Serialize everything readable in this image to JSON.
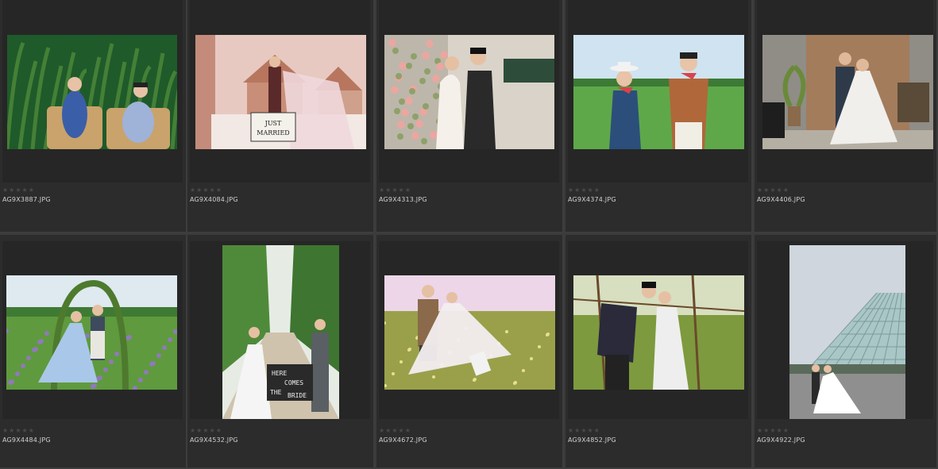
{
  "gallery": {
    "items": [
      {
        "filename": "AG9X3887.JPG",
        "rating": "★★★★★",
        "scene": "garden-rattan-chairs",
        "colors": [
          "#1f5a2a",
          "#4e8a3a",
          "#c9a36b",
          "#3b5ea8"
        ]
      },
      {
        "filename": "AG9X4084.JPG",
        "rating": "★★★★★",
        "scene": "thai-temple-just-married",
        "colors": [
          "#e7c9c1",
          "#c48b7a",
          "#f2e8e4",
          "#5a2a2a"
        ]
      },
      {
        "filename": "AG9X4313.JPG",
        "rating": "★★★★★",
        "scene": "flower-wall-couple",
        "colors": [
          "#d9d3c9",
          "#8fa16a",
          "#2a2a2a",
          "#f5f0ea"
        ]
      },
      {
        "filename": "AG9X4374.JPG",
        "rating": "★★★★★",
        "scene": "watermelon-field",
        "colors": [
          "#cfe3f1",
          "#5fa84a",
          "#2b4f7a",
          "#b0673a"
        ]
      },
      {
        "filename": "AG9X4406.JPG",
        "rating": "★★★★★",
        "scene": "studio-curtain",
        "colors": [
          "#a37c5c",
          "#5a4a3a",
          "#2e3a4a",
          "#f0efec"
        ]
      },
      {
        "filename": "AG9X4484.JPG",
        "rating": "★★★★★",
        "scene": "flower-arch-field",
        "colors": [
          "#dfe9f0",
          "#5f9a3e",
          "#8f7ab8",
          "#a9c7e8"
        ]
      },
      {
        "filename": "AG9X4532.JPG",
        "rating": "★★★★★",
        "scene": "path-here-comes-the-bride",
        "colors": [
          "#e6ece4",
          "#4f8a3a",
          "#cfc3ad",
          "#2a2a2a"
        ]
      },
      {
        "filename": "AG9X4672.JPG",
        "rating": "★★★★★",
        "scene": "meadow-couple",
        "colors": [
          "#ecd6e8",
          "#9aa04a",
          "#8a6a4a",
          "#f3eef0"
        ]
      },
      {
        "filename": "AG9X4852.JPG",
        "rating": "★★★★★",
        "scene": "fence-kiss",
        "colors": [
          "#d7dfc0",
          "#7d9a3e",
          "#2a2a3a",
          "#eeeeee"
        ]
      },
      {
        "filename": "AG9X4922.JPG",
        "rating": "★★★★★",
        "scene": "glass-pyramid",
        "colors": [
          "#cfd6dd",
          "#a9c7c7",
          "#8f8f8f",
          "#ffffff"
        ]
      }
    ],
    "bride_sign": {
      "line1": "HERE",
      "line2": "COMES",
      "line3": "THE",
      "line4": "BRIDE"
    },
    "just_married": {
      "line1": "JUST",
      "line2": "MARRIED"
    }
  }
}
